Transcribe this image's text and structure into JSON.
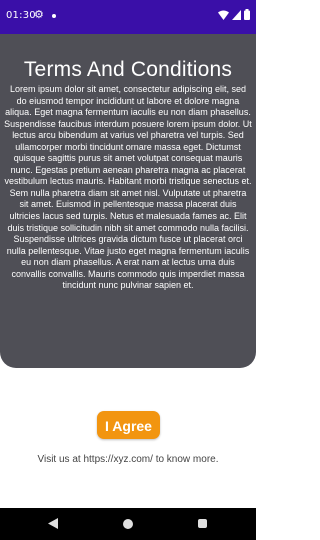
{
  "status_bar": {
    "time": "01:30",
    "icons": [
      "settings-gear-icon",
      "notification-dot-icon",
      "wifi-icon",
      "signal-icon",
      "battery-icon"
    ]
  },
  "terms": {
    "title": "Terms And Conditions",
    "body": "Lorem ipsum dolor sit amet, consectetur adipiscing elit, sed do eiusmod tempor incididunt ut labore et dolore magna aliqua. Eget magna fermentum iaculis eu non diam phasellus. Suspendisse faucibus interdum posuere lorem ipsum dolor. Ut lectus arcu bibendum at varius vel pharetra vel turpis. Sed ullamcorper morbi tincidunt ornare massa eget. Dictumst quisque sagittis purus sit amet volutpat consequat mauris nunc. Egestas pretium aenean pharetra magna ac placerat vestibulum lectus mauris. Habitant morbi tristique senectus et. Sem nulla pharetra diam sit amet nisl. Vulputate ut pharetra sit amet. Euismod in pellentesque massa placerat duis ultricies lacus sed turpis. Netus et malesuada fames ac. Elit duis tristique sollicitudin nibh sit amet commodo nulla facilisi. Suspendisse ultrices gravida dictum fusce ut placerat orci nulla pellentesque. Vitae justo eget magna fermentum iaculis eu non diam phasellus. A erat nam at lectus urna duis convallis convallis. Mauris commodo quis imperdiet massa tincidunt nunc pulvinar sapien et."
  },
  "agree_button": {
    "label": "I Agree"
  },
  "footer": {
    "visit_text": "Visit us at https://xyz.com/ to know more."
  },
  "nav_bar": {
    "icons": [
      "back-icon",
      "home-icon",
      "recents-icon"
    ]
  },
  "colors": {
    "status_bar": "#3a0fa8",
    "card_background": "#4f4f56",
    "accent_button": "#f29510",
    "nav_bar": "#000000"
  }
}
